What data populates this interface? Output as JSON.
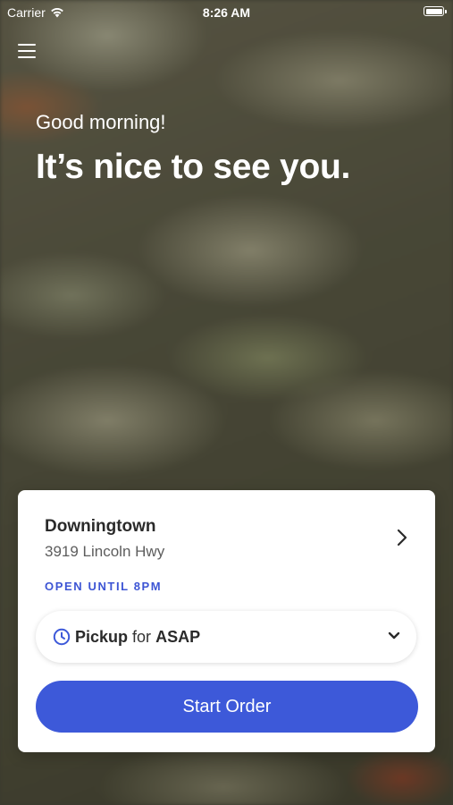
{
  "status_bar": {
    "carrier": "Carrier",
    "time": "8:26 AM"
  },
  "header": {
    "greeting": "Good morning!",
    "headline": "It’s nice to see you."
  },
  "location": {
    "name": "Downingtown",
    "address": "3919 Lincoln Hwy",
    "hours": "OPEN UNTIL 8PM"
  },
  "order_type": {
    "mode": "Pickup",
    "connector": "for",
    "time": "ASAP"
  },
  "start_button": {
    "label": "Start Order"
  },
  "icons": {
    "menu": "hamburger-menu-icon",
    "clock": "clock-icon",
    "chevron_right": "chevron-right-icon",
    "chevron_down": "chevron-down-icon"
  },
  "colors": {
    "accent": "#3d59d9",
    "hours_text": "#3d55d4"
  }
}
